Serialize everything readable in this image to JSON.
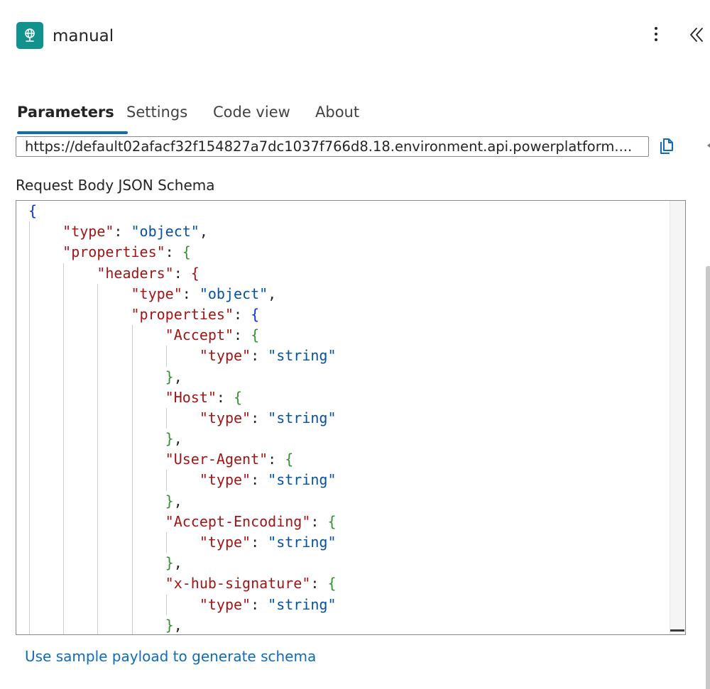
{
  "header": {
    "title": "manual",
    "icon": "webhook-globe-icon",
    "accent_color": "#11928d"
  },
  "tabs": [
    {
      "label": "Parameters",
      "active": true
    },
    {
      "label": "Settings",
      "active": false
    },
    {
      "label": "Code view",
      "active": false
    },
    {
      "label": "About",
      "active": false
    }
  ],
  "url_field": {
    "value": "https://default02afacf32f154827a7dc1037f766d8.18.environment.api.powerplatform...."
  },
  "schema": {
    "label": "Request Body JSON Schema",
    "lines": [
      {
        "indent": 0,
        "tokens": [
          {
            "t": "{",
            "c": "b1"
          }
        ]
      },
      {
        "indent": 1,
        "tokens": [
          {
            "t": "\"type\"",
            "c": "k"
          },
          {
            "t": ": ",
            "c": "p"
          },
          {
            "t": "\"object\"",
            "c": "s"
          },
          {
            "t": ",",
            "c": "p"
          }
        ]
      },
      {
        "indent": 1,
        "tokens": [
          {
            "t": "\"properties\"",
            "c": "k"
          },
          {
            "t": ": ",
            "c": "p"
          },
          {
            "t": "{",
            "c": "b2"
          }
        ]
      },
      {
        "indent": 2,
        "tokens": [
          {
            "t": "\"headers\"",
            "c": "k"
          },
          {
            "t": ": ",
            "c": "p"
          },
          {
            "t": "{",
            "c": "k"
          }
        ]
      },
      {
        "indent": 3,
        "tokens": [
          {
            "t": "\"type\"",
            "c": "k"
          },
          {
            "t": ": ",
            "c": "p"
          },
          {
            "t": "\"object\"",
            "c": "s"
          },
          {
            "t": ",",
            "c": "p"
          }
        ]
      },
      {
        "indent": 3,
        "tokens": [
          {
            "t": "\"properties\"",
            "c": "k"
          },
          {
            "t": ": ",
            "c": "p"
          },
          {
            "t": "{",
            "c": "b1"
          }
        ]
      },
      {
        "indent": 4,
        "tokens": [
          {
            "t": "\"Accept\"",
            "c": "k"
          },
          {
            "t": ": ",
            "c": "p"
          },
          {
            "t": "{",
            "c": "b2"
          }
        ]
      },
      {
        "indent": 5,
        "tokens": [
          {
            "t": "\"type\"",
            "c": "k"
          },
          {
            "t": ": ",
            "c": "p"
          },
          {
            "t": "\"string\"",
            "c": "s"
          }
        ]
      },
      {
        "indent": 4,
        "tokens": [
          {
            "t": "}",
            "c": "b2"
          },
          {
            "t": ",",
            "c": "p"
          }
        ]
      },
      {
        "indent": 4,
        "tokens": [
          {
            "t": "\"Host\"",
            "c": "k"
          },
          {
            "t": ": ",
            "c": "p"
          },
          {
            "t": "{",
            "c": "b2"
          }
        ]
      },
      {
        "indent": 5,
        "tokens": [
          {
            "t": "\"type\"",
            "c": "k"
          },
          {
            "t": ": ",
            "c": "p"
          },
          {
            "t": "\"string\"",
            "c": "s"
          }
        ]
      },
      {
        "indent": 4,
        "tokens": [
          {
            "t": "}",
            "c": "b2"
          },
          {
            "t": ",",
            "c": "p"
          }
        ]
      },
      {
        "indent": 4,
        "tokens": [
          {
            "t": "\"User-Agent\"",
            "c": "k"
          },
          {
            "t": ": ",
            "c": "p"
          },
          {
            "t": "{",
            "c": "b2"
          }
        ]
      },
      {
        "indent": 5,
        "tokens": [
          {
            "t": "\"type\"",
            "c": "k"
          },
          {
            "t": ": ",
            "c": "p"
          },
          {
            "t": "\"string\"",
            "c": "s"
          }
        ]
      },
      {
        "indent": 4,
        "tokens": [
          {
            "t": "}",
            "c": "b2"
          },
          {
            "t": ",",
            "c": "p"
          }
        ]
      },
      {
        "indent": 4,
        "tokens": [
          {
            "t": "\"Accept-Encoding\"",
            "c": "k"
          },
          {
            "t": ": ",
            "c": "p"
          },
          {
            "t": "{",
            "c": "b2"
          }
        ]
      },
      {
        "indent": 5,
        "tokens": [
          {
            "t": "\"type\"",
            "c": "k"
          },
          {
            "t": ": ",
            "c": "p"
          },
          {
            "t": "\"string\"",
            "c": "s"
          }
        ]
      },
      {
        "indent": 4,
        "tokens": [
          {
            "t": "}",
            "c": "b2"
          },
          {
            "t": ",",
            "c": "p"
          }
        ]
      },
      {
        "indent": 4,
        "tokens": [
          {
            "t": "\"x-hub-signature\"",
            "c": "k"
          },
          {
            "t": ": ",
            "c": "p"
          },
          {
            "t": "{",
            "c": "b2"
          }
        ]
      },
      {
        "indent": 5,
        "tokens": [
          {
            "t": "\"type\"",
            "c": "k"
          },
          {
            "t": ": ",
            "c": "p"
          },
          {
            "t": "\"string\"",
            "c": "s"
          }
        ]
      },
      {
        "indent": 4,
        "tokens": [
          {
            "t": "}",
            "c": "b2"
          },
          {
            "t": ",",
            "c": "p"
          }
        ]
      }
    ]
  },
  "sample_link": "Use sample payload to generate schema"
}
